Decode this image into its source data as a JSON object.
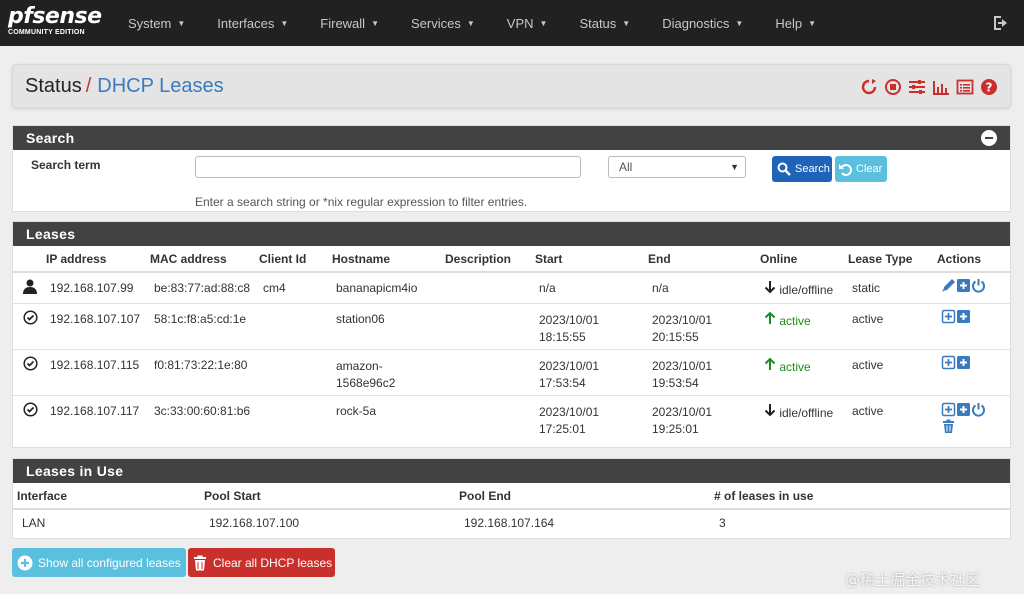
{
  "app": {
    "logo_text": "pfsense",
    "logo_sub": "COMMUNITY EDITION"
  },
  "nav": {
    "items": [
      {
        "label": "System"
      },
      {
        "label": "Interfaces"
      },
      {
        "label": "Firewall"
      },
      {
        "label": "Services"
      },
      {
        "label": "VPN"
      },
      {
        "label": "Status"
      },
      {
        "label": "Diagnostics"
      },
      {
        "label": "Help"
      }
    ],
    "logout_icon": "sign-out-icon"
  },
  "breadcrumb": {
    "section": "Status",
    "separator": "/",
    "page": "DHCP Leases",
    "icons": [
      "restart-icon",
      "stop-icon",
      "settings-sliders-icon",
      "bar-chart-icon",
      "log-list-icon",
      "help-icon"
    ]
  },
  "search_panel": {
    "title": "Search",
    "term_label": "Search term",
    "input_value": "",
    "select_value": "All",
    "search_button": "Search",
    "clear_button": "Clear",
    "help_text": "Enter a search string or *nix regular expression to filter entries."
  },
  "leases_panel": {
    "title": "Leases",
    "columns": [
      "IP address",
      "MAC address",
      "Client Id",
      "Hostname",
      "Description",
      "Start",
      "End",
      "Online",
      "Lease Type",
      "Actions"
    ],
    "rows": [
      {
        "status_icon": "user-icon",
        "ip": "192.168.107.99",
        "mac": "be:83:77:ad:88:c8",
        "client_id": "cm4",
        "hostname": "bananapicm4io",
        "description": "",
        "start": "n/a",
        "start_time": "",
        "end": "n/a",
        "end_time": "",
        "online_icon": "arrow-down-icon",
        "online": "idle/offline",
        "lease_type": "static",
        "actions": [
          "edit-icon",
          "add-icon",
          "power-icon"
        ]
      },
      {
        "status_icon": "check-circle-icon",
        "ip": "192.168.107.107",
        "mac": "58:1c:f8:a5:cd:1e",
        "client_id": "",
        "hostname": "station06",
        "description": "",
        "start": "2023/10/01",
        "start_time": "18:15:55",
        "end": "2023/10/01",
        "end_time": "20:15:55",
        "online_icon": "arrow-up-icon",
        "online": "active",
        "lease_type": "active",
        "actions": [
          "add-outline-icon",
          "add-icon"
        ]
      },
      {
        "status_icon": "check-circle-icon",
        "ip": "192.168.107.115",
        "mac": "f0:81:73:22:1e:80",
        "client_id": "",
        "hostname": "amazon-",
        "hostname2": "1568e96c2",
        "description": "",
        "start": "2023/10/01",
        "start_time": "17:53:54",
        "end": "2023/10/01",
        "end_time": "19:53:54",
        "online_icon": "arrow-up-icon",
        "online": "active",
        "lease_type": "active",
        "actions": [
          "add-outline-icon",
          "add-icon"
        ]
      },
      {
        "status_icon": "check-circle-icon",
        "ip": "192.168.107.117",
        "mac": "3c:33:00:60:81:b6",
        "client_id": "",
        "hostname": "rock-5a",
        "description": "",
        "start": "2023/10/01",
        "start_time": "17:25:01",
        "end": "2023/10/01",
        "end_time": "19:25:01",
        "online_icon": "arrow-down-icon",
        "online": "idle/offline",
        "lease_type": "active",
        "actions": [
          "add-outline-icon",
          "add-icon",
          "power-icon",
          "trash-icon"
        ]
      }
    ]
  },
  "leases_in_use_panel": {
    "title": "Leases in Use",
    "columns": [
      "Interface",
      "Pool Start",
      "Pool End",
      "# of leases in use"
    ],
    "rows": [
      {
        "interface": "LAN",
        "pool_start": "192.168.107.100",
        "pool_end": "192.168.107.164",
        "count": "3"
      }
    ]
  },
  "buttons": {
    "show_all": "Show all configured leases",
    "clear_all": "Clear all DHCP leases"
  },
  "watermark": "@稀土掘金技术社区",
  "colors": {
    "navbar": "#212121",
    "panel_header": "#424242",
    "primary": "#1e64b9",
    "info": "#5bc0de",
    "danger": "#c9302c",
    "link": "#3a7bbf",
    "success": "#1a8f1a"
  }
}
